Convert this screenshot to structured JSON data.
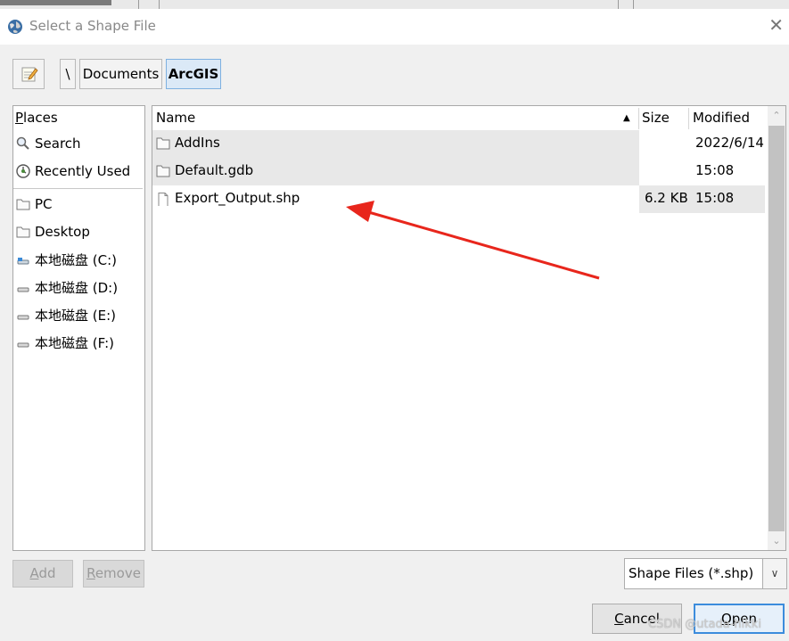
{
  "window": {
    "title": "Select a Shape File",
    "close_glyph": "✕",
    "icon": "globe-icon"
  },
  "pathbar": {
    "edit_icon": "edit-location-icon",
    "root": "\\",
    "crumbs": [
      "Documents",
      "ArcGIS"
    ],
    "active_crumb": "ArcGIS"
  },
  "places": {
    "header_first": "P",
    "header_rest": "laces",
    "items": [
      {
        "label": "Search",
        "icon": "search-icon"
      },
      {
        "label": "Recently Used",
        "icon": "recent-icon"
      },
      {
        "label": "PC",
        "icon": "folder-icon"
      },
      {
        "label": "Desktop",
        "icon": "folder-icon"
      },
      {
        "label": "本地磁盘 (C:)",
        "icon": "drive-icon"
      },
      {
        "label": "本地磁盘 (D:)",
        "icon": "drive-icon"
      },
      {
        "label": "本地磁盘 (E:)",
        "icon": "drive-icon"
      },
      {
        "label": "本地磁盘 (F:)",
        "icon": "drive-icon"
      }
    ]
  },
  "files": {
    "columns": {
      "name": "Name",
      "size": "Size",
      "modified": "Modified",
      "sort_glyph": "▲"
    },
    "rows": [
      {
        "name": "AddIns",
        "size": "",
        "modified": "2022/6/14",
        "icon": "folder-icon"
      },
      {
        "name": "Default.gdb",
        "size": "",
        "modified": "15:08",
        "icon": "folder-icon"
      },
      {
        "name": "Export_Output.shp",
        "size": "6.2 KB",
        "modified": "15:08",
        "icon": "file-icon"
      }
    ],
    "scroll_up": "⌃",
    "scroll_down": "⌄"
  },
  "buttons": {
    "add_first": "A",
    "add_rest": "dd",
    "remove_first": "R",
    "remove_rest": "emove",
    "cancel_first": "C",
    "cancel_rest": "ancel",
    "open_first": "O",
    "open_rest": "pen"
  },
  "filter": {
    "selected": "Shape Files (*.shp)",
    "arrow": "∨"
  },
  "watermark": "CSDN @utada-hikki",
  "colors": {
    "annotation_arrow": "#e8261c",
    "selection_accent": "#3c8cdc"
  }
}
